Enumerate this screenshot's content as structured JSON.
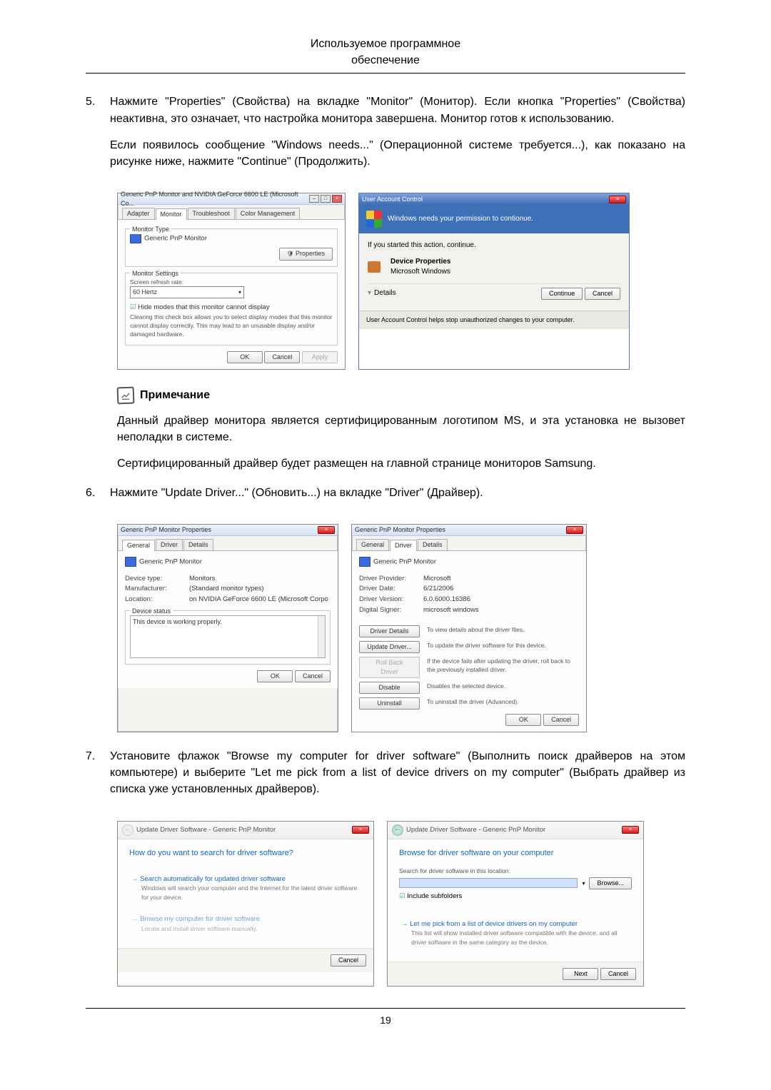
{
  "header": {
    "line1": "Используемое программное",
    "line2": "обеспечение"
  },
  "steps": {
    "s5": {
      "num": "5.",
      "p1": "Нажмите \"Properties\" (Свойства) на вкладке \"Monitor\" (Монитор). Если кнопка \"Properties\" (Свойства) неактивна, это означает, что настройка монитора завершена. Монитор готов к использованию.",
      "p2": "Если появилось сообщение \"Windows needs...\" (Операционной системе требуется...), как показано на рисунке ниже, нажмите \"Continue\" (Продолжить)."
    },
    "s6": {
      "num": "6.",
      "p1": "Нажмите \"Update Driver...\" (Обновить...) на вкладке \"Driver\" (Драйвер)."
    },
    "s7": {
      "num": "7.",
      "p1": "Установите флажок \"Browse my computer for driver software\" (Выполнить поиск драйверов на этом компьютере) и выберите \"Let me pick from a list of device drivers on my computer\" (Выбрать драйвер из списка уже установленных драйверов)."
    }
  },
  "note": {
    "title": "Примечание",
    "p1": "Данный драйвер монитора является сертифицированным логотипом MS, и эта установка не вызовет неполадки в системе.",
    "p2": "Сертифицированный драйвер будет размещен на главной странице мониторов Samsung."
  },
  "dlg_monitor": {
    "title": "Generic PnP Monitor and NVIDIA GeForce 6600 LE (Microsoft Co...",
    "tabs": {
      "adapter": "Adapter",
      "monitor": "Monitor",
      "troubleshoot": "Troubleshoot",
      "color": "Color Management"
    },
    "monitor_type_legend": "Monitor Type",
    "monitor_name": "Generic PnP Monitor",
    "properties_btn": "Properties",
    "settings_legend": "Monitor Settings",
    "refresh_label": "Screen refresh rate:",
    "refresh_value": "60 Hertz",
    "hide_label": "Hide modes that this monitor cannot display",
    "hide_desc": "Clearing this check box allows you to select display modes that this monitor cannot display correctly. This may lead to an unusable display and/or damaged hardware.",
    "ok": "OK",
    "cancel": "Cancel",
    "apply": "Apply"
  },
  "dlg_uac": {
    "title": "User Account Control",
    "banner": "Windows needs your permission to contionue.",
    "line_if": "If you started this action, continue.",
    "dev_prop": "Device Properties",
    "ms_win": "Microsoft Windows",
    "details": "Details",
    "continue": "Continue",
    "cancel": "Cancel",
    "footer": "User Account Control helps stop unauthorized changes to your computer."
  },
  "dlg_general": {
    "title": "Generic PnP Monitor Properties",
    "tabs": {
      "general": "General",
      "driver": "Driver",
      "details": "Details"
    },
    "name": "Generic PnP Monitor",
    "k_type": "Device type:",
    "v_type": "Monitors",
    "k_man": "Manufacturer:",
    "v_man": "(Standard monitor types)",
    "k_loc": "Location:",
    "v_loc": "on NVIDIA GeForce 6600 LE (Microsoft Corpo",
    "status_legend": "Device status",
    "status_text": "This device is working properly.",
    "ok": "OK",
    "cancel": "Cancel"
  },
  "dlg_driver": {
    "title": "Generic PnP Monitor Properties",
    "tabs": {
      "general": "General",
      "driver": "Driver",
      "details": "Details"
    },
    "name": "Generic PnP Monitor",
    "k_prov": "Driver Provider:",
    "v_prov": "Microsoft",
    "k_date": "Driver Date:",
    "v_date": "6/21/2006",
    "k_ver": "Driver Version:",
    "v_ver": "6.0.6000.16386",
    "k_sig": "Digital Signer:",
    "v_sig": "microsoft windows",
    "b_details": "Driver Details",
    "d_details": "To view details about the driver files.",
    "b_update": "Update Driver...",
    "d_update": "To update the driver software for this device.",
    "b_roll": "Roll Back Driver",
    "d_roll": "If the device fails after updating the driver, roll back to the previously installed driver.",
    "b_disable": "Disable",
    "d_disable": "Disables the selected device.",
    "b_uninstall": "Uninstall",
    "d_uninstall": "To uninstall the driver (Advanced).",
    "ok": "OK",
    "cancel": "Cancel"
  },
  "wiz1": {
    "crumb": "Update Driver Software - Generic PnP Monitor",
    "heading": "How do you want to search for driver software?",
    "opt1_lead": "Search automatically for updated driver software",
    "opt1_sub": "Windows will search your computer and the Internet for the latest driver software for your device.",
    "opt2_lead": "Browse my computer for driver software",
    "opt2_sub": "Locate and install driver software manually.",
    "cancel": "Cancel"
  },
  "wiz2": {
    "crumb": "Update Driver Software - Generic PnP Monitor",
    "heading": "Browse for driver software on your computer",
    "search_label": "Search for driver software in this location:",
    "browse": "Browse...",
    "include": "Include subfolders",
    "opt_lead": "Let me pick from a list of device drivers on my computer",
    "opt_sub": "This list will show installed driver software compatible with the device, and all driver software in the same category as the device.",
    "next": "Next",
    "cancel": "Cancel"
  },
  "page_number": "19"
}
